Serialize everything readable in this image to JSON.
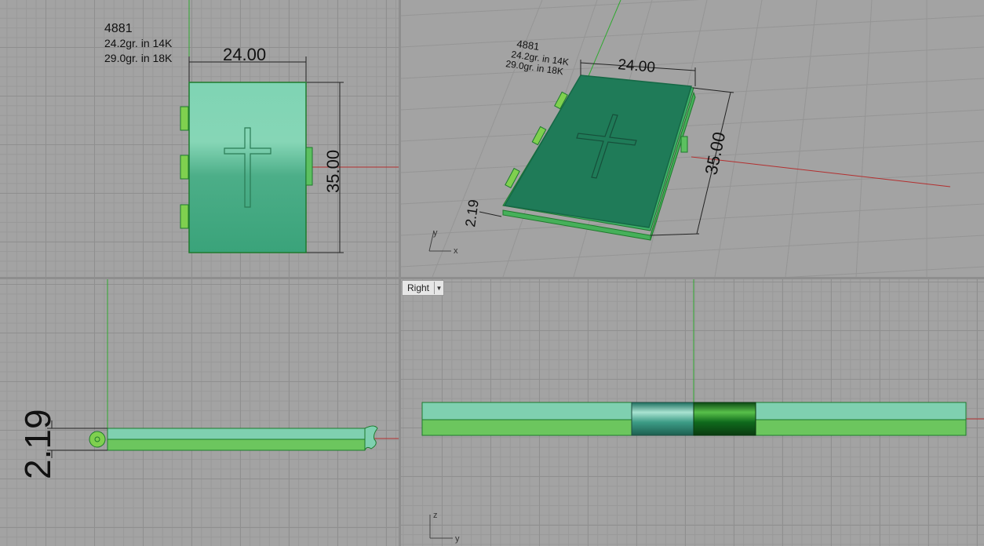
{
  "annotation": {
    "part_number": "4881",
    "weight_14k": "24.2gr.  in 14K",
    "weight_18k": "29.0gr.  in 18K"
  },
  "dimensions": {
    "width": "24.00",
    "height": "35.00",
    "thickness": "2.19"
  },
  "viewports": {
    "right": {
      "label": "Right"
    }
  },
  "axes": {
    "persp_x": "x",
    "persp_y": "y",
    "right_z": "z",
    "right_y": "y"
  },
  "colors": {
    "viewport_bg": "#a3a3a3",
    "model_light": "#7fd0b0",
    "model_dark": "#2e9e72",
    "outline": "#1e7a2c",
    "axis_x": "#b32f2f",
    "axis_y": "#2fa82f"
  }
}
